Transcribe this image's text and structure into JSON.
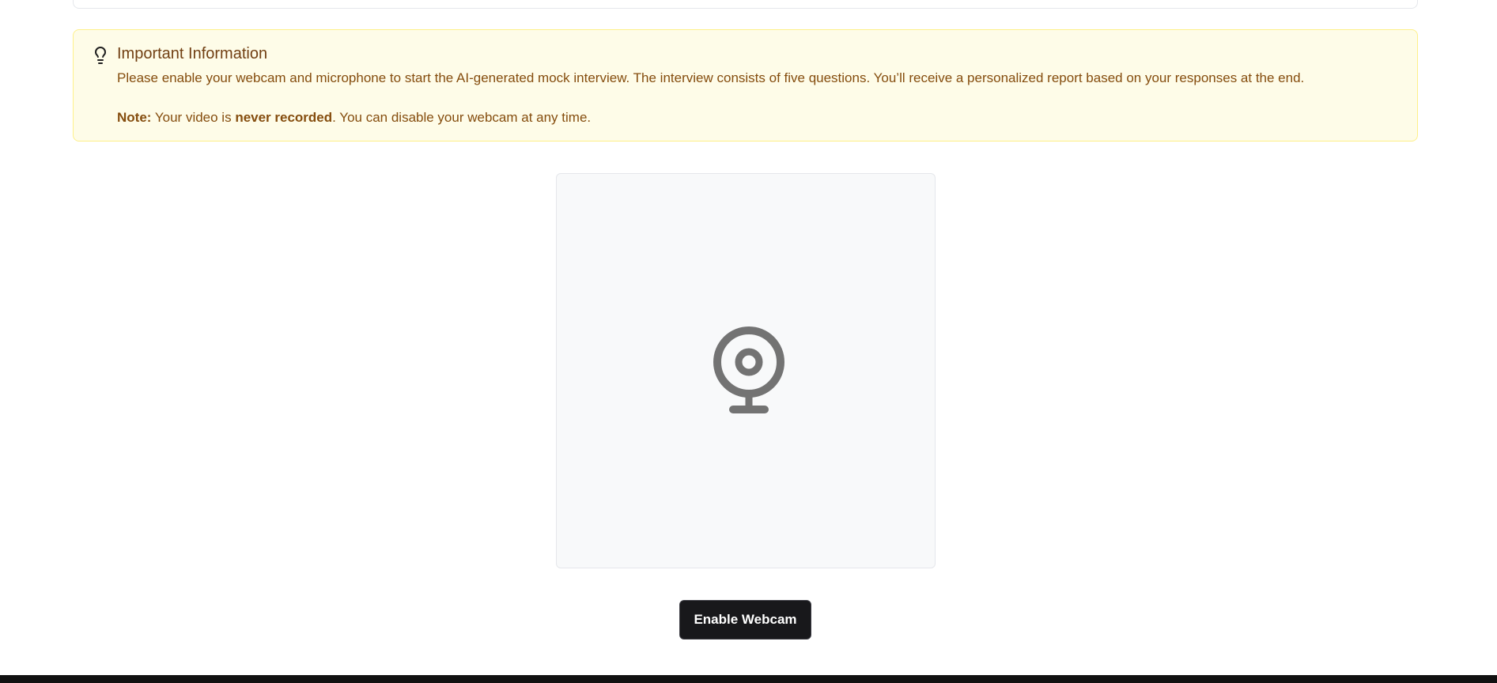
{
  "info": {
    "icon": "lightbulb-icon",
    "title": "Important Information",
    "body": "Please enable your webcam and microphone to start the AI-generated mock interview. The interview consists of five questions. You’ll receive a personalized report based on your responses at the end.",
    "note_label": "Note:",
    "note_prefix": " Your video is ",
    "note_emphasis": "never recorded",
    "note_suffix": ". You can disable your webcam at any time."
  },
  "webcam": {
    "icon": "webcam-icon"
  },
  "actions": {
    "enable_label": "Enable Webcam"
  },
  "colors": {
    "info_background": "#fefce8",
    "info_border": "#fef08a",
    "info_title": "#713f12",
    "info_text": "#854d0e",
    "button_background": "#18181b",
    "icon_gray": "#737373"
  }
}
